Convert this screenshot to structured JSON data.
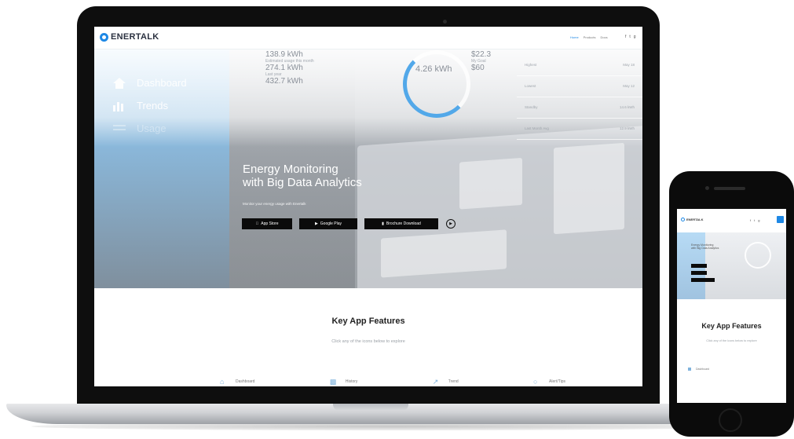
{
  "brand": {
    "name": "ENERTALK",
    "accent": "#1e88e5"
  },
  "nav": {
    "links": [
      "Home",
      "Products",
      "Docs"
    ],
    "social": [
      "f",
      "t",
      "g"
    ]
  },
  "dashboard": {
    "menu": [
      {
        "label": "Dashboard",
        "icon": "dashboard-icon"
      },
      {
        "label": "Trends",
        "icon": "bar-chart-icon"
      },
      {
        "label": "Usage",
        "icon": "list-icon"
      }
    ],
    "usage_main": "138.9 kWh",
    "usage_caption": "Estimated usage this month",
    "usage_estimate": "274.1 kWh",
    "usage_last_caption": "Last year",
    "usage_last": "432.7 kWh",
    "ring_value": "4.26 kWh",
    "bill_value": "$22.3",
    "bill_caption": "My Goal",
    "bill_goal": "$60",
    "table": [
      {
        "label": "Highest",
        "value": "May 18"
      },
      {
        "label": "Lowest",
        "value": "May 12"
      },
      {
        "label": "Standby",
        "value": "14.6 kWh"
      },
      {
        "label": "Last Month Avg",
        "value": "12.9 kWh"
      }
    ]
  },
  "hero": {
    "title_line1": "Energy Monitoring",
    "title_line2": "with Big Data Analytics",
    "subtitle": "Monitor your energy usage with Enertalk",
    "buttons": [
      {
        "label": "App Store",
        "icon": "apple-icon"
      },
      {
        "label": "Google Play",
        "icon": "play-store-icon"
      },
      {
        "label": "Brochure Download",
        "icon": "document-icon"
      }
    ]
  },
  "features": {
    "title": "Key App Features",
    "subtitle": "Click any of the icons below to explore",
    "items": [
      "Dashboard",
      "History",
      "Trend",
      "Alert/Tips"
    ]
  },
  "phone": {
    "title_line1": "Energy Monitoring",
    "title_line2": "with Big Data Analytics",
    "features_title": "Key App Features",
    "features_sub": "Click any of the icons below to explore",
    "feature_item": "Dashboard"
  }
}
